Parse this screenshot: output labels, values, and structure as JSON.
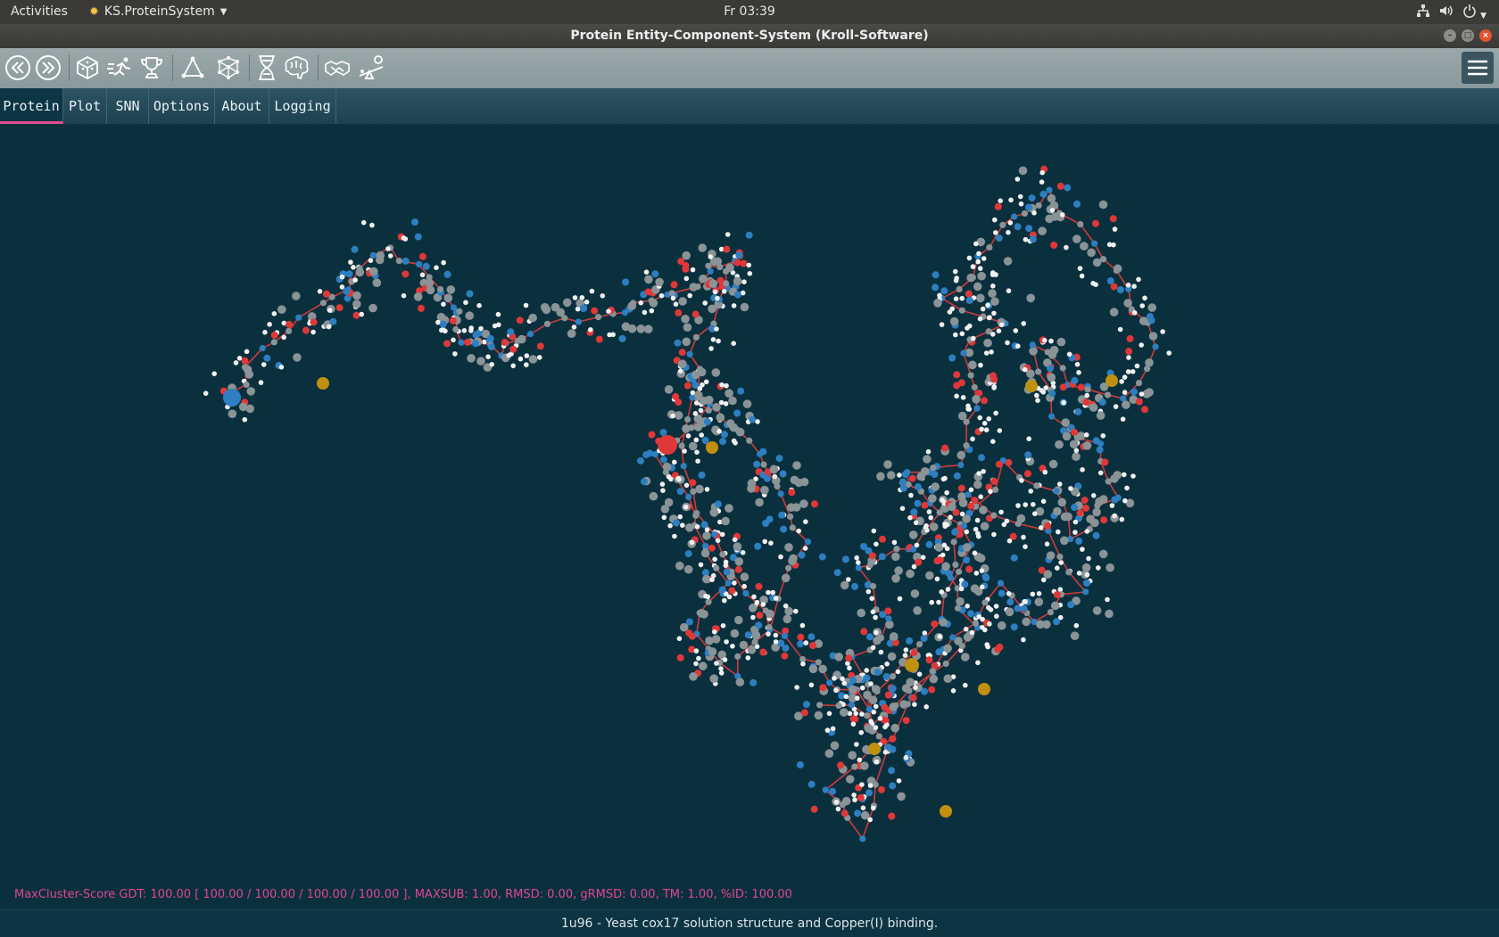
{
  "system_bar": {
    "activities": "Activities",
    "app_menu": "KS.ProteinSystem",
    "clock": "Fr 03:39",
    "tray_icons": [
      "network-icon",
      "volume-icon",
      "power-icon"
    ]
  },
  "window": {
    "title": "Protein Entity-Component-System (Kroll-Software)"
  },
  "toolbar": {
    "icons": [
      "back-icon",
      "forward-icon",
      "cube-dice-icon",
      "runner-icon",
      "trophy-icon",
      "triangle-graph-icon",
      "molecule-network-icon",
      "hourglass-dna-icon",
      "brain-icon",
      "handshake-icon",
      "seesaw-icon"
    ],
    "menu_icon": "hamburger-menu-icon"
  },
  "tabs": [
    {
      "label": "Protein",
      "active": true
    },
    {
      "label": "Plot",
      "active": false
    },
    {
      "label": "SNN",
      "active": false
    },
    {
      "label": "Options",
      "active": false
    },
    {
      "label": "About",
      "active": false
    },
    {
      "label": "Logging",
      "active": false
    }
  ],
  "viewer": {
    "colors": {
      "background": "#0a303e",
      "backbone": "#d03a3a",
      "oxygen": "#e03838",
      "nitrogen": "#2d7fc1",
      "carbon": "#8a9396",
      "hydrogen": "#f0f0f0",
      "copper": "#c09010"
    }
  },
  "score_line": "MaxCluster-Score GDT: 100.00  [ 100.00 / 100.00 / 100.00 / 100.00 ], MAXSUB: 1.00, RMSD: 0.00, gRMSD: 0.00, TM: 1.00, %ID: 100.00",
  "status": "1u96 - Yeast cox17 solution structure and Copper(I) binding."
}
